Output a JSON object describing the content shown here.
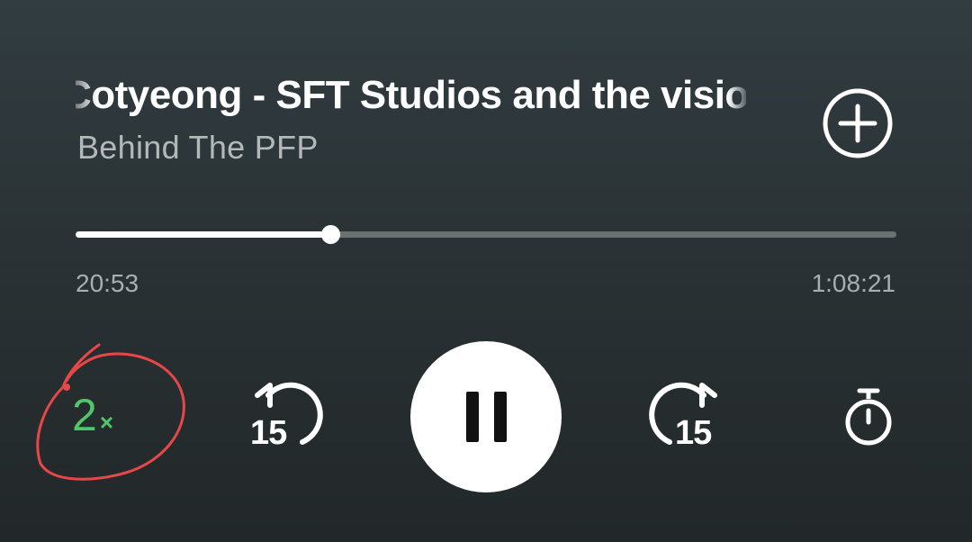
{
  "episode": {
    "title": "Cotyeong - SFT Studios and the vision",
    "show": "Behind The PFP"
  },
  "playback": {
    "elapsed": "20:53",
    "total": "1:08:21",
    "progress_fraction": 0.31,
    "speed_number": "2",
    "speed_suffix": "×",
    "skip_back_seconds": "15",
    "skip_forward_seconds": "15",
    "is_playing": true
  },
  "icons": {
    "add": "add-circle-icon",
    "pause": "pause-icon",
    "skip_back": "rewind-15-icon",
    "skip_forward": "forward-15-icon",
    "timer": "sleep-timer-icon"
  },
  "colors": {
    "background": "#2b3336",
    "accent": "#4fc66a",
    "annotation": "#e8474a",
    "progress_fill": "#ffffff",
    "progress_track": "#6b7071"
  }
}
